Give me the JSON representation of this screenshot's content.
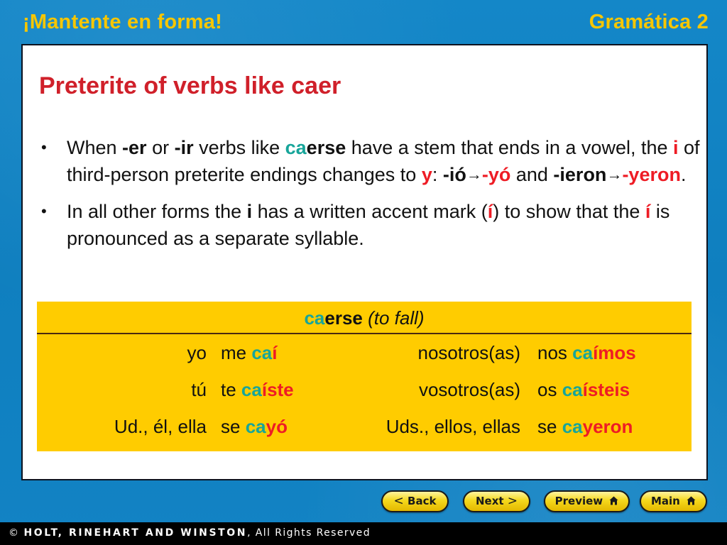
{
  "header": {
    "left_title": "¡Mantente en forma!",
    "right_title": "Gramática 2"
  },
  "colors": {
    "background_blue": "#0f7fc0",
    "header_yellow": "#f7c600",
    "title_red": "#d0202a",
    "accent_red": "#ee1c25",
    "accent_teal": "#17a59a",
    "table_yellow": "#ffcc00"
  },
  "slide": {
    "title": "Preterite of verbs like caer",
    "bullets": [
      {
        "marker": "•",
        "parts": {
          "t1": "When ",
          "t2": "-er",
          "t3": " or ",
          "t4": "-ir",
          "t5": " verbs like ",
          "t6_teal": "ca",
          "t7_bold": "erse",
          "t8": " have a stem that ends in a vowel, the ",
          "t9_red": "i",
          "t10": " of third-person preterite endings changes to ",
          "t11_red": "y",
          "t12": ": ",
          "t13": "-ió",
          "arrow1": "→",
          "t14_red": "-yó",
          "t15": " and ",
          "t16": "-ieron",
          "arrow2": "→",
          "t17_red": "-yeron",
          "t18": "."
        }
      },
      {
        "marker": "•",
        "parts": {
          "t1": "In all other forms the ",
          "t2": "i",
          "t3": " has a written accent mark (",
          "t4_red": "í",
          "t5": ") to show that the ",
          "t6_red": "í",
          "t7": " is pronounced as a separate syllable."
        }
      }
    ]
  },
  "conjugation_table": {
    "header": {
      "stem_teal": "ca",
      "rest_bold": "erse",
      "gloss": " (to fall)"
    },
    "rows": [
      {
        "pronoun1": "yo",
        "reflexive1": "me ",
        "stem1": "ca",
        "ending1": "í",
        "pronoun2": "nosotros(as)",
        "reflexive2": "nos ",
        "stem2": "ca",
        "ending2": "ímos"
      },
      {
        "pronoun1": "tú",
        "reflexive1": "te ",
        "stem1": "ca",
        "ending1": "íste",
        "pronoun2": "vosotros(as)",
        "reflexive2": "os ",
        "stem2": "ca",
        "ending2": "ísteis"
      },
      {
        "pronoun1": "Ud., él, ella",
        "reflexive1": "se ",
        "stem1": "ca",
        "ending1": "yó",
        "pronoun2": "Uds., ellos, ellas",
        "reflexive2": "se ",
        "stem2": "ca",
        "ending2": "yeron"
      }
    ]
  },
  "navigation": {
    "back": {
      "label": "Back",
      "icon": "chevron-left-icon",
      "glyph": "<"
    },
    "next": {
      "label": "Next",
      "icon": "chevron-right-icon",
      "glyph": ">"
    },
    "preview": {
      "label": "Preview",
      "icon": "home-icon"
    },
    "main": {
      "label": "Main",
      "icon": "home-icon"
    }
  },
  "footer": {
    "copyright_symbol": "©",
    "publisher": " HOLT, RINEHART AND WINSTON",
    "rights": ", All Rights Reserved"
  }
}
